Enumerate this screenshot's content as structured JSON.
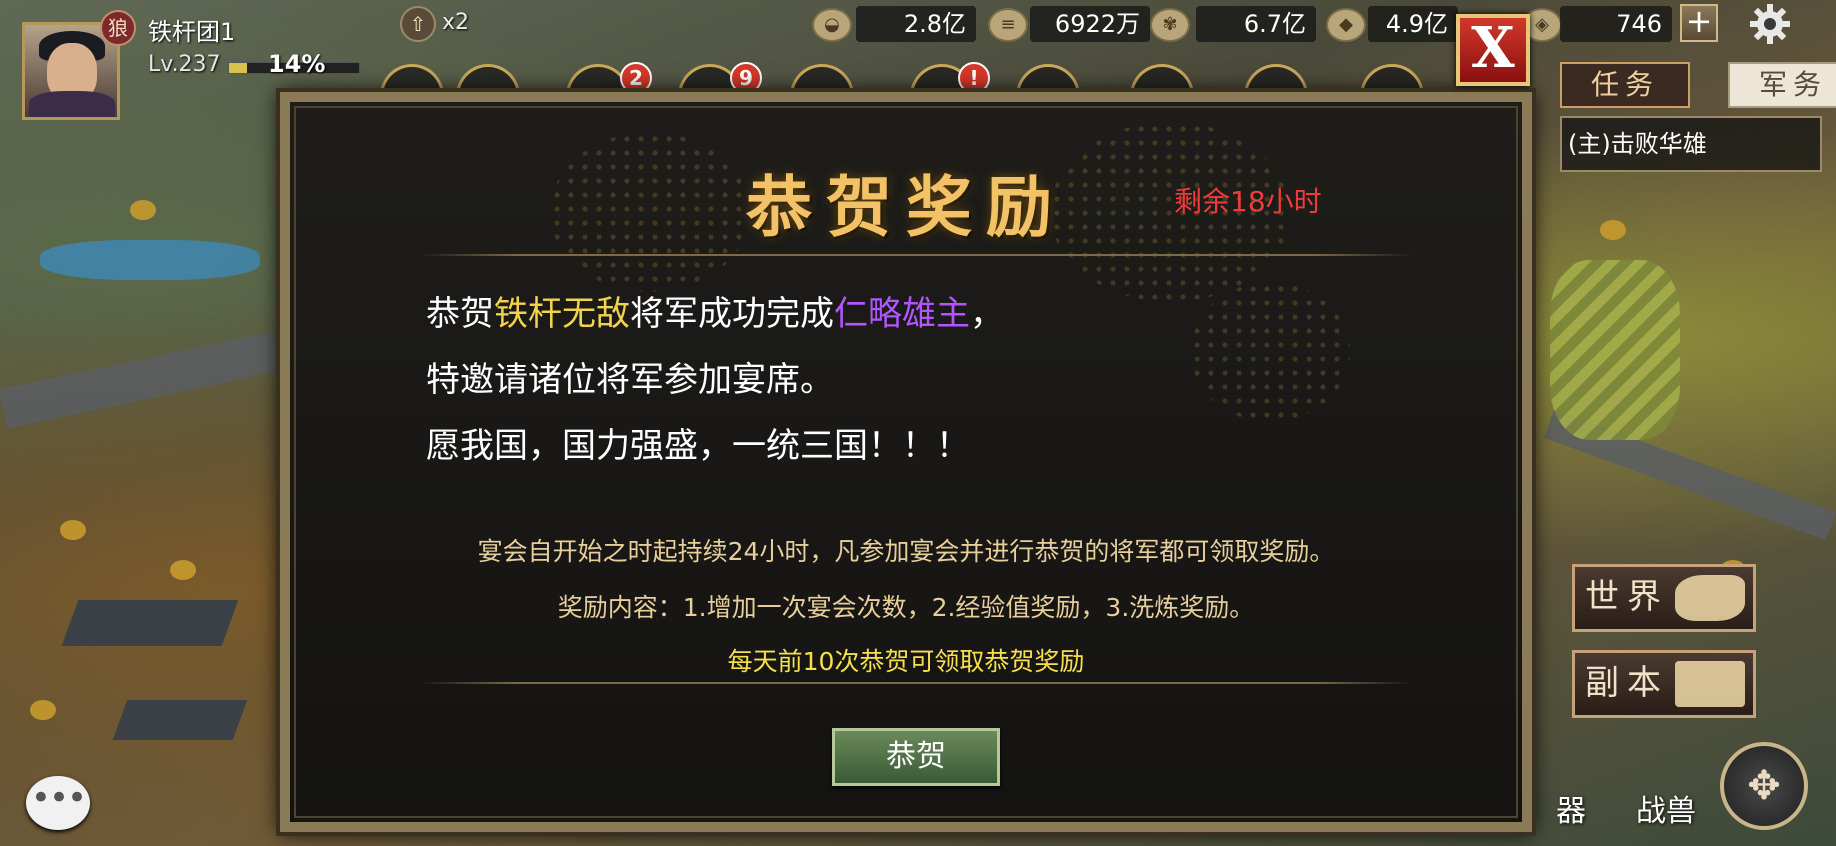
{
  "player": {
    "faction_glyph": "狼",
    "name": "铁杆团1",
    "level": "Lv.237",
    "exp_percent": "14%",
    "exp_fraction": 0.14
  },
  "upgrade": {
    "multiplier": "x2"
  },
  "resources": [
    {
      "icon": "gold-ingot-icon",
      "value": "2.8亿"
    },
    {
      "icon": "wood-icon",
      "value": "6922万"
    },
    {
      "icon": "grain-icon",
      "value": "6.7亿"
    },
    {
      "icon": "ore-icon",
      "value": "4.9亿"
    },
    {
      "icon": "yuanbao-icon",
      "value": "746"
    }
  ],
  "badges": {
    "mail": "2",
    "chat": "9",
    "alert": "!"
  },
  "right_panel": {
    "tabs": {
      "active": "任务",
      "inactive": "军务"
    },
    "quest": "(主)击败华雄",
    "world_button": "世界",
    "dungeon_button": "副本",
    "bottom_labels": [
      "器",
      "战兽"
    ]
  },
  "modal": {
    "title": "恭贺奖励",
    "timer": "剩余18小时",
    "line1_prefix": "恭贺",
    "line1_player": "铁杆无敌",
    "line1_mid": "将军成功完成",
    "line1_achievement": "仁略雄主",
    "line1_suffix": "，",
    "line2": "特邀请诸位将军参加宴席。",
    "line3": "愿我国，国力强盛，一统三国！！！",
    "info1": "宴会自开始之时起持续24小时，凡参加宴会并进行恭贺的将军都可领取奖励。",
    "info2": "奖励内容：1.增加一次宴会次数，2.经验值奖励，3.洗炼奖励。",
    "info3": "每天前10次恭贺可领取恭贺奖励",
    "button": "恭贺"
  },
  "colors": {
    "title_gold": "#f3c266",
    "timer_red": "#ee3b3b",
    "player_highlight": "#f3d24e",
    "achievement_purple": "#b156ff",
    "button_green": "#3a5a36"
  }
}
